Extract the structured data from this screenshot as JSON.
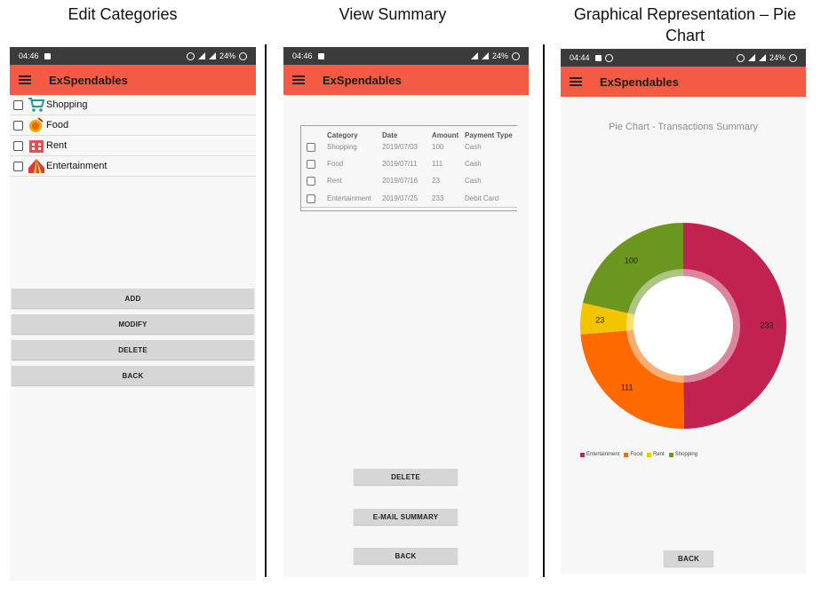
{
  "captions": {
    "left": "Edit Categories",
    "middle": "View Summary",
    "right": "Graphical Representation – Pie Chart"
  },
  "screens": {
    "edit": {
      "time": "04:46",
      "battery": "24%",
      "app_title": "ExSpendables",
      "categories": [
        {
          "label": "Shopping",
          "icon": "shopping-cart-icon"
        },
        {
          "label": "Food",
          "icon": "food-icon"
        },
        {
          "label": "Rent",
          "icon": "rent-building-icon"
        },
        {
          "label": "Entertainment",
          "icon": "circus-tent-icon"
        }
      ],
      "buttons": {
        "add": "ADD",
        "modify": "MODIFY",
        "delete": "DELETE",
        "back": "BACK"
      }
    },
    "summary": {
      "time": "04:46",
      "battery": "24%",
      "app_title": "ExSpendables",
      "columns": [
        "Category",
        "Date",
        "Amount",
        "Payment Type"
      ],
      "rows": [
        [
          "Shopping",
          "2019/07/03",
          "100",
          "Cash"
        ],
        [
          "Food",
          "2019/07/11",
          "111",
          "Cash"
        ],
        [
          "Rent",
          "2019/07/16",
          "23",
          "Cash"
        ],
        [
          "Entertainment",
          "2019/07/25",
          "233",
          "Debit Card"
        ]
      ],
      "buttons": {
        "delete": "DELETE",
        "email": "E-MAIL SUMMARY",
        "back": "BACK"
      }
    },
    "pie": {
      "time": "04:44",
      "battery": "24%",
      "app_title": "ExSpendables",
      "back": "BACK"
    }
  },
  "chart_data": {
    "type": "pie",
    "title": "Pie Chart - Transactions Summary",
    "donut": true,
    "categories": [
      "Entertainment",
      "Food",
      "Rent",
      "Shopping"
    ],
    "values": [
      233,
      111,
      23,
      100
    ],
    "colors": [
      "#c2224f",
      "#ff6a00",
      "#f2c500",
      "#6b9620"
    ],
    "legend": "bottom-left"
  },
  "colors": {
    "appbar": "#f45a44",
    "statusbar": "#3b3b3b",
    "button": "#d6d6d6"
  }
}
